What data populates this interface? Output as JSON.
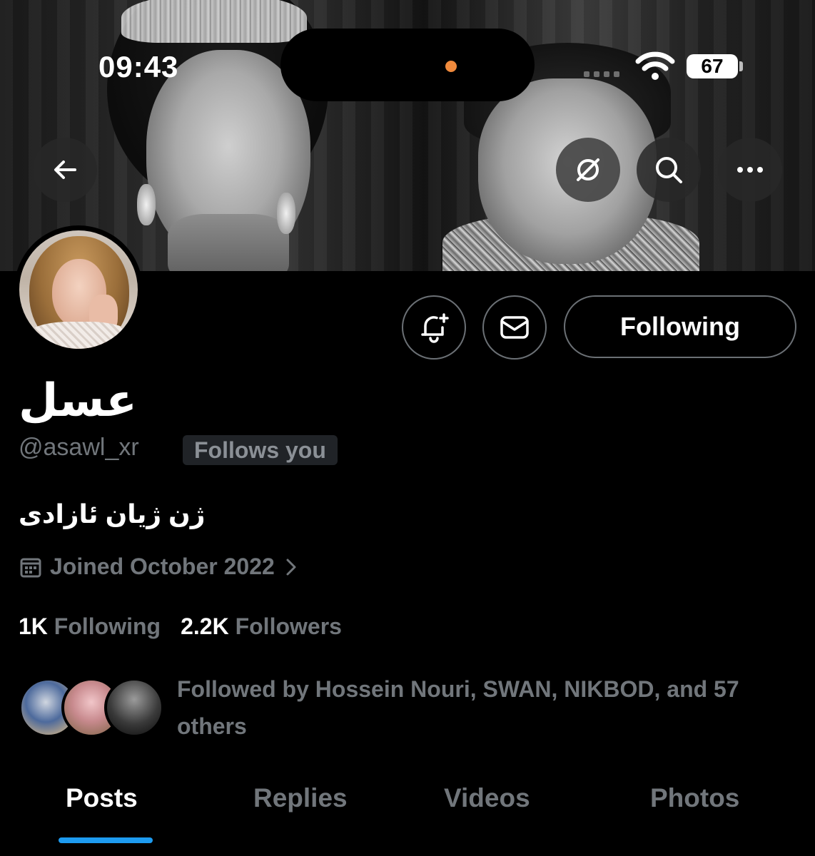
{
  "status_bar": {
    "time": "09:43",
    "battery": "67"
  },
  "nav": {
    "back_icon": "arrow-left-icon",
    "grok_icon": "slashed-circle-icon",
    "search_icon": "search-icon",
    "more_icon": "more-horizontal-icon"
  },
  "profile": {
    "display_name": "عسل",
    "handle": "@asawl_xr",
    "follows_you": "Follows you",
    "bio": "ژن ژیان ئازادی",
    "joined": "Joined October 2022",
    "following_count": "1K",
    "following_label": "Following",
    "followers_count": "2.2K",
    "followers_label": "Followers",
    "followed_by": "Followed by Hossein Nouri, SWAN, NIKBOD, and 57 others"
  },
  "actions": {
    "notify_icon": "bell-plus-icon",
    "message_icon": "mail-icon",
    "following_button": "Following"
  },
  "tabs": [
    {
      "label": "Posts",
      "active": true
    },
    {
      "label": "Replies",
      "active": false
    },
    {
      "label": "Videos",
      "active": false
    },
    {
      "label": "Photos",
      "active": false
    }
  ],
  "colors": {
    "accent": "#1d9bf0",
    "background": "#000000",
    "secondary_text": "#71767b",
    "status_dot": "#f08a3c"
  }
}
